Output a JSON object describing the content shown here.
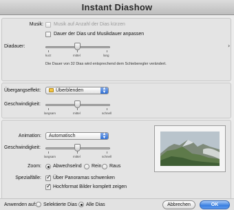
{
  "window": {
    "title": "Instant Diashow"
  },
  "music": {
    "label": "Musik:",
    "repeat_checkbox_label": "Musik auf Anzahl der Dias kürzen",
    "fit_checkbox_label": "Dauer der Dias und Musikdauer anpassen"
  },
  "slide_duration": {
    "label": "Diadauer:",
    "ticks": [
      "kurz",
      "mittel",
      "lang"
    ],
    "value": 0.5,
    "note": "Die Dauer von 32 Dias wird entsprechend dem Schieberegler verändert."
  },
  "transition": {
    "label": "Übergangseffekt:",
    "value": "Überblenden",
    "speed_label": "Geschwindigkeit:",
    "speed_ticks": [
      "langsam",
      "mittel",
      "schnell"
    ],
    "speed_value": 0.5
  },
  "animation": {
    "label": "Animation:",
    "value": "Automatisch",
    "speed_label": "Geschwindigkeit:",
    "speed_ticks": [
      "langsam",
      "mittel",
      "schnell"
    ],
    "speed_value": 0.5,
    "zoom_label": "Zoom:",
    "zoom_options": [
      "Abwechselnd",
      "Rein",
      "Raus"
    ],
    "zoom_selected": "Abwechselnd",
    "special_label": "Spezialfälle:",
    "pan_label": "Über Panoramas schwenken",
    "portrait_label": "Hochformat Bilder komplett zeigen"
  },
  "apply": {
    "label": "Anwenden auf:",
    "options": [
      "Selektierte Dias",
      "Alle Dias"
    ],
    "selected": "Alle Dias"
  },
  "buttons": {
    "cancel": "Abbrechen",
    "ok": "OK"
  },
  "icons": {
    "collapse": "chevron-right-icon",
    "popup": "popup-arrows-icon"
  }
}
